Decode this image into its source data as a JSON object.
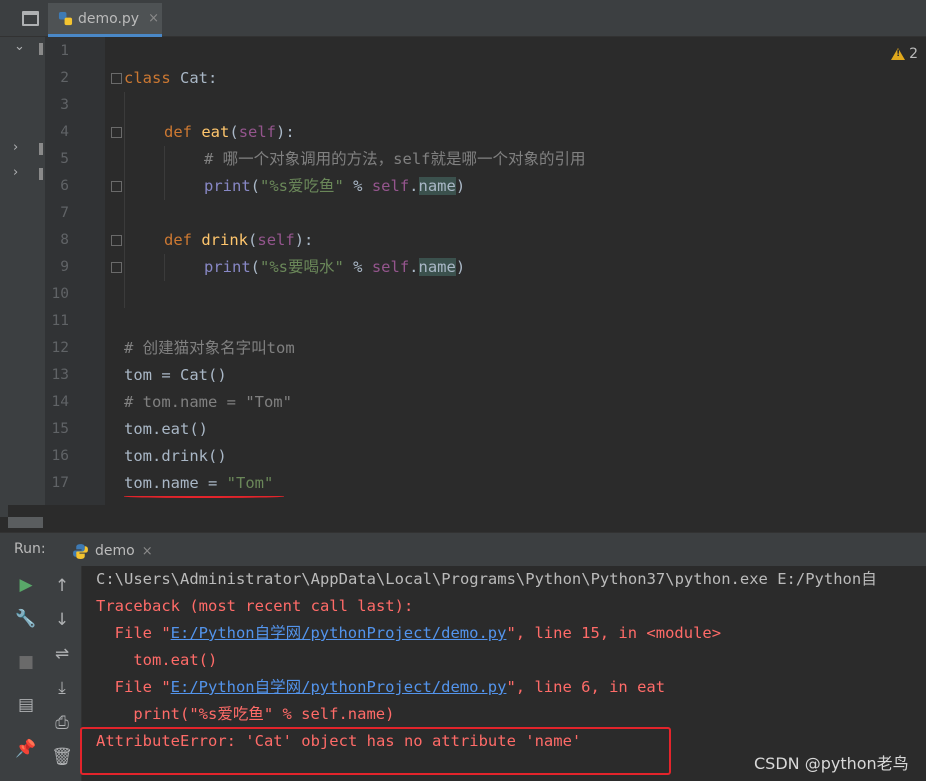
{
  "editor_tab": {
    "filename": "demo.py",
    "close_glyph": "×"
  },
  "warnings": {
    "count": "2"
  },
  "line_numbers": [
    "1",
    "2",
    "3",
    "4",
    "5",
    "6",
    "7",
    "8",
    "9",
    "10",
    "11",
    "12",
    "13",
    "14",
    "15",
    "16",
    "17"
  ],
  "code": {
    "l2_kw": "class",
    "l2_rest": " Cat:",
    "l4_kw": "def",
    "l4_fn": "eat",
    "l4_self": "self",
    "l4_open": "(",
    "l4_close": "):",
    "l5": "# 哪一个对象调用的方法，self就是哪一个对象的引用",
    "l6_print": "print",
    "l6_open": "(",
    "l6_str": "\"%s爱吃鱼\"",
    "l6_op": " % ",
    "l6_self": "self",
    "l6_dot": ".",
    "l6_attr": "name",
    "l6_close": ")",
    "l8_kw": "def",
    "l8_fn": "drink",
    "l8_self": "self",
    "l8_open": "(",
    "l8_close": "):",
    "l9_print": "print",
    "l9_open": "(",
    "l9_str": "\"%s要喝水\"",
    "l9_op": " % ",
    "l9_self": "self",
    "l9_dot": ".",
    "l9_attr": "name",
    "l9_close": ")",
    "l12": "# 创建猫对象名字叫tom",
    "l13": "tom = Cat()",
    "l14": "# tom.name = \"Tom\"",
    "l15": "tom.eat()",
    "l16": "tom.drink()",
    "l17_left": "tom.name = ",
    "l17_str": "\"Tom\""
  },
  "run_panel": {
    "title": "Run:",
    "tab_label": "demo",
    "close_glyph": "×"
  },
  "console": {
    "line1": "C:\\Users\\Administrator\\AppData\\Local\\Programs\\Python\\Python37\\python.exe E:/Python自",
    "line2": "Traceback (most recent call last):",
    "line3_pre": "  File \"",
    "line3_link": "E:/Python自学网/pythonProject/demo.py",
    "line3_post": "\", line 15, in <module>",
    "line4": "    tom.eat()",
    "line5_pre": "  File \"",
    "line5_link": "E:/Python自学网/pythonProject/demo.py",
    "line5_post": "\", line 6, in eat",
    "line6": "    print(\"%s爱吃鱼\" % self.name)",
    "line7": "AttributeError: 'Cat' object has no attribute 'name'"
  },
  "tool_icons": {
    "col1": [
      "run-icon",
      "wrench-icon",
      "stop-icon",
      "layout-icon",
      "pin-icon"
    ],
    "col2": [
      "up-arrow-icon",
      "down-arrow-icon",
      "soft-wrap-icon",
      "scroll-to-end-icon",
      "print-icon",
      "trash-icon"
    ]
  },
  "watermark": "CSDN @python老鸟",
  "colors": {
    "keyword": "#cc7832",
    "function": "#ffc66d",
    "self": "#94558d",
    "string": "#6a8759",
    "comment": "#808080",
    "error": "#ff6b68",
    "link": "#5394ec",
    "highlight_box": "#e3242b"
  }
}
